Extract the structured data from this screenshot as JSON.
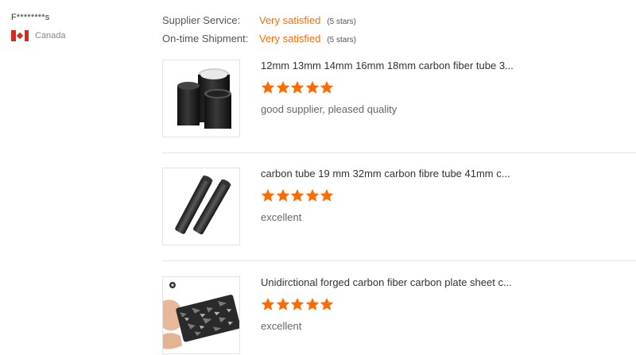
{
  "reviewer": {
    "name": "F********s",
    "country": "Canada"
  },
  "ratings": [
    {
      "label": "Supplier Service:",
      "value": "Very satisfied",
      "stars": "(5 stars)"
    },
    {
      "label": "On-time Shipment:",
      "value": "Very satisfied",
      "stars": "(5 stars)"
    }
  ],
  "products": [
    {
      "title": "12mm 13mm 14mm 16mm 18mm carbon fiber tube 3...",
      "rating": 5,
      "comment": "good supplier, pleased quality",
      "icon": "carbon-tube-photo"
    },
    {
      "title": "carbon tube 19 mm 32mm carbon fibre tube 41mm c...",
      "rating": 5,
      "comment": "excellent",
      "icon": "carbon-rod-photo"
    },
    {
      "title": "Unidirctional forged carbon fiber carbon plate sheet c...",
      "rating": 5,
      "comment": "excellent",
      "icon": "carbon-plate-photo"
    }
  ],
  "colors": {
    "accent": "#ff6a00",
    "divider": "#e3e3e3"
  }
}
